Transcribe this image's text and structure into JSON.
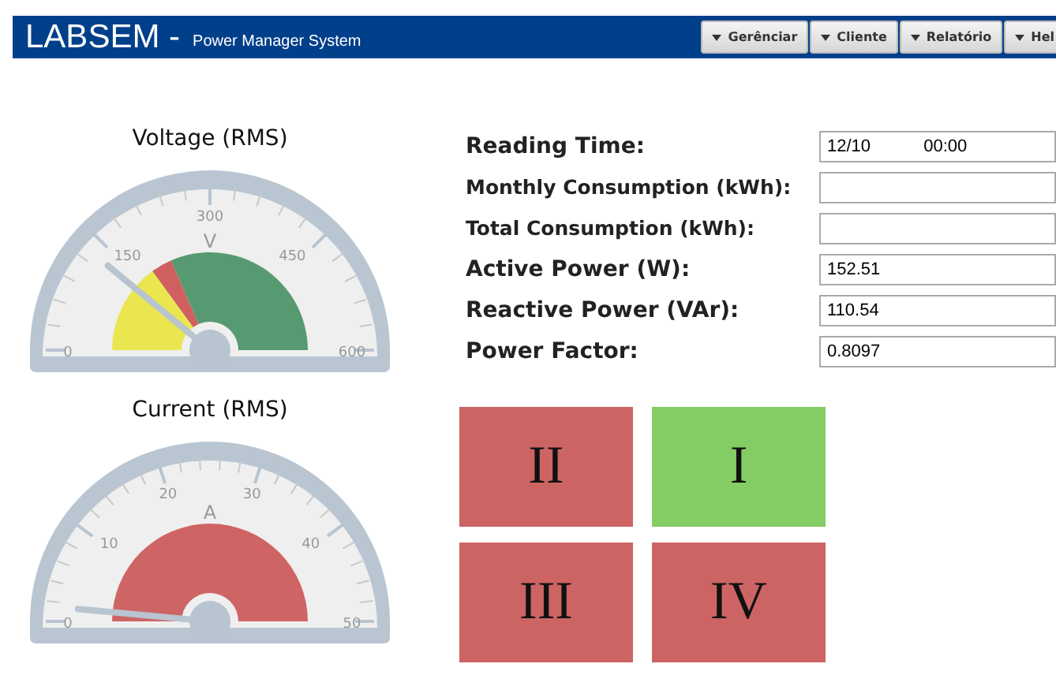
{
  "header": {
    "title": "LABSEM -",
    "subtitle": "Power Manager System",
    "menus": [
      {
        "label": "Gerênciar"
      },
      {
        "label": "Cliente"
      },
      {
        "label": "Relatório"
      },
      {
        "label": "Hel"
      }
    ]
  },
  "gauges": [
    {
      "title": "Voltage (RMS)",
      "unit": "V",
      "ticks": [
        "0",
        "150",
        "300",
        "450",
        "600"
      ],
      "bands": [
        {
          "color": "#e9e650"
        },
        {
          "color": "#d0605f"
        },
        {
          "color": "#579a72"
        }
      ]
    },
    {
      "title": "Current (RMS)",
      "unit": "A",
      "ticks": [
        "0",
        "10",
        "20",
        "30",
        "40",
        "50"
      ],
      "bands": [
        {
          "color": "#cf6464"
        }
      ]
    }
  ],
  "readings": [
    {
      "label": "Reading Time:",
      "value": "12/10           00:00"
    },
    {
      "label": "Monthly Consumption (kWh):"
    },
    {
      "label": "Total Consumption (kWh):"
    },
    {
      "label": "Active Power (W):",
      "value": "152.51"
    },
    {
      "label": "Reactive Power (VAr):",
      "value": "110.54"
    },
    {
      "label": "Power Factor:",
      "value": "0.8097"
    }
  ],
  "quadrants": [
    {
      "label": "II",
      "color": "#cd6464"
    },
    {
      "label": "I",
      "color": "#84cc64"
    },
    {
      "label": "III",
      "color": "#cd6464"
    },
    {
      "label": "IV",
      "color": "#cd6464"
    }
  ]
}
